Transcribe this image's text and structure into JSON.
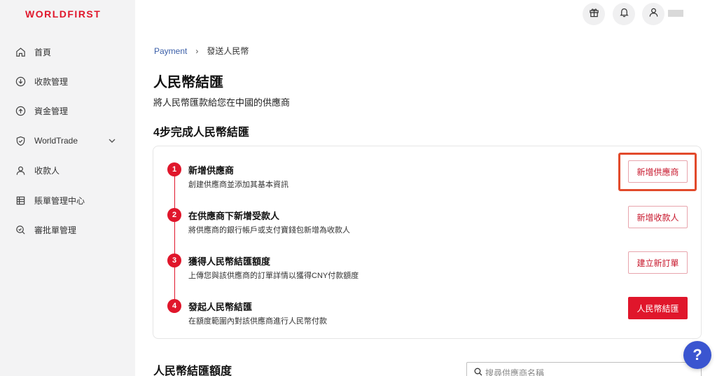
{
  "app": {
    "logo": "WORLDFIRST"
  },
  "sidebar": {
    "items": [
      {
        "label": "首頁",
        "icon": "home-icon"
      },
      {
        "label": "收款管理",
        "icon": "download-circle-icon"
      },
      {
        "label": "資金管理",
        "icon": "upload-circle-icon"
      },
      {
        "label": "WorldTrade",
        "icon": "shield-icon",
        "expandable": true
      },
      {
        "label": "收款人",
        "icon": "user-icon"
      },
      {
        "label": "賬單管理中心",
        "icon": "ledger-icon"
      },
      {
        "label": "審批單管理",
        "icon": "approval-search-icon"
      }
    ]
  },
  "topbar": {
    "icons": [
      "gift-icon",
      "bell-icon",
      "user-icon"
    ]
  },
  "breadcrumb": {
    "parent": "Payment",
    "separator": "›",
    "current": "發送人民幣"
  },
  "page": {
    "title": "人民幣結匯",
    "subtitle": "將人民幣匯款給您在中國的供應商",
    "steps_heading": "4步完成人民幣結匯"
  },
  "steps": [
    {
      "number": "1",
      "title": "新增供應商",
      "description": "創建供應商並添加其基本資訊",
      "button": "新增供應商"
    },
    {
      "number": "2",
      "title": "在供應商下新增受款人",
      "description": "將供應商的銀行帳戶或支付寶錢包新增為收款人",
      "button": "新增收款人"
    },
    {
      "number": "3",
      "title": "獲得人民幣結匯額度",
      "description": "上傳您與該供應商的訂單詳情以獲得CNY付款額度",
      "button": "建立新訂單"
    },
    {
      "number": "4",
      "title": "發起人民幣結匯",
      "description": "在額度範圍內對該供應商進行人民幣付款",
      "button": "人民幣結匯"
    }
  ],
  "quota": {
    "title": "人民幣結匯額度",
    "search_placeholder": "搜尋供應商名稱"
  },
  "help": {
    "label": "?"
  },
  "colors": {
    "brand_red": "#e0162b",
    "link_blue": "#3b5fa8",
    "help_blue": "#3a55d0",
    "highlight": "#e24a2b"
  }
}
